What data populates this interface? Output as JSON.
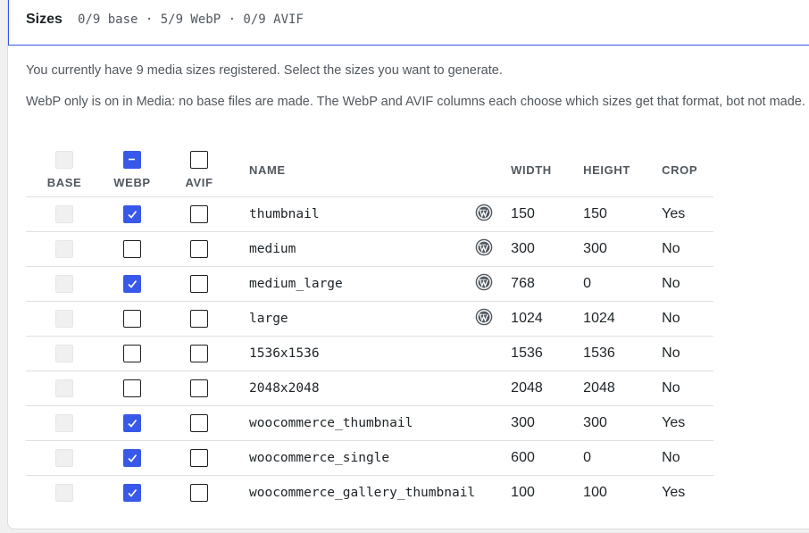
{
  "header": {
    "title": "Sizes",
    "summary": "0/9 base · 5/9 WebP · 0/9 AVIF"
  },
  "intro": "You currently have 9 media sizes registered. Select the sizes you want to generate.",
  "note": "WebP only is on in Media: no base files are made. The WebP and AVIF columns each choose which sizes get that format, bot not made.",
  "columns": {
    "base": "BASE",
    "webp": "WEBP",
    "avif": "AVIF",
    "name": "NAME",
    "width": "WIDTH",
    "height": "HEIGHT",
    "crop": "CROP"
  },
  "header_checkboxes": {
    "base": "disabled",
    "webp": "mixed",
    "avif": "unchecked"
  },
  "icons": {
    "wordpress": "wordpress-icon"
  },
  "colors": {
    "accent": "#3858e9"
  },
  "rows": [
    {
      "name": "thumbnail",
      "core": true,
      "width": "150",
      "height": "150",
      "crop": "Yes",
      "webp": true,
      "avif": false
    },
    {
      "name": "medium",
      "core": true,
      "width": "300",
      "height": "300",
      "crop": "No",
      "webp": false,
      "avif": false
    },
    {
      "name": "medium_large",
      "core": true,
      "width": "768",
      "height": "0",
      "crop": "No",
      "webp": true,
      "avif": false
    },
    {
      "name": "large",
      "core": true,
      "width": "1024",
      "height": "1024",
      "crop": "No",
      "webp": false,
      "avif": false
    },
    {
      "name": "1536x1536",
      "core": false,
      "width": "1536",
      "height": "1536",
      "crop": "No",
      "webp": false,
      "avif": false
    },
    {
      "name": "2048x2048",
      "core": false,
      "width": "2048",
      "height": "2048",
      "crop": "No",
      "webp": false,
      "avif": false
    },
    {
      "name": "woocommerce_thumbnail",
      "core": false,
      "width": "300",
      "height": "300",
      "crop": "Yes",
      "webp": true,
      "avif": false
    },
    {
      "name": "woocommerce_single",
      "core": false,
      "width": "600",
      "height": "0",
      "crop": "No",
      "webp": true,
      "avif": false
    },
    {
      "name": "woocommerce_gallery_thumbnail",
      "core": false,
      "width": "100",
      "height": "100",
      "crop": "Yes",
      "webp": true,
      "avif": false
    }
  ]
}
